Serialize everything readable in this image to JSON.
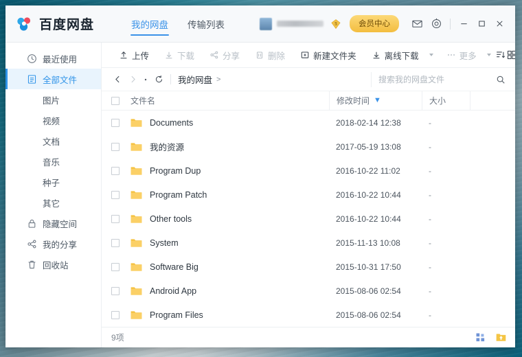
{
  "app": {
    "brand_name": "百度网盘",
    "logo_icon": "baidu-netdisk-logo"
  },
  "tabs": [
    {
      "label": "我的网盘",
      "active": true
    },
    {
      "label": "传输列表",
      "active": false
    }
  ],
  "account": {
    "username_masked": "",
    "diamond_icon": "diamond-badge-icon",
    "vip_label": "会员中心"
  },
  "titlebar_icons": [
    {
      "name": "mail-icon",
      "glyph": "mail"
    },
    {
      "name": "settings-icon",
      "glyph": "gear"
    }
  ],
  "window_controls": [
    {
      "name": "minimize-button",
      "glyph": "minimize"
    },
    {
      "name": "maximize-button",
      "glyph": "maximize"
    },
    {
      "name": "close-button",
      "glyph": "close"
    }
  ],
  "sidebar": {
    "items": [
      {
        "label": "最近使用",
        "icon": "clock-icon",
        "active": false
      },
      {
        "label": "全部文件",
        "icon": "file-list-icon",
        "active": true
      },
      {
        "label": "图片",
        "icon": "",
        "active": false
      },
      {
        "label": "视频",
        "icon": "",
        "active": false
      },
      {
        "label": "文档",
        "icon": "",
        "active": false
      },
      {
        "label": "音乐",
        "icon": "",
        "active": false
      },
      {
        "label": "种子",
        "icon": "",
        "active": false
      },
      {
        "label": "其它",
        "icon": "",
        "active": false
      },
      {
        "label": "隐藏空间",
        "icon": "lock-icon",
        "active": false
      },
      {
        "label": "我的分享",
        "icon": "share-icon",
        "active": false
      },
      {
        "label": "回收站",
        "icon": "trash-icon",
        "active": false
      }
    ]
  },
  "toolbar": {
    "buttons": [
      {
        "label": "上传",
        "icon": "upload-icon",
        "disabled": false,
        "caret": false
      },
      {
        "label": "下载",
        "icon": "download-icon",
        "disabled": true,
        "caret": false
      },
      {
        "label": "分享",
        "icon": "share-icon",
        "disabled": true,
        "caret": false
      },
      {
        "label": "删除",
        "icon": "trash-icon",
        "disabled": true,
        "caret": false
      },
      {
        "label": "新建文件夹",
        "icon": "new-folder-icon",
        "disabled": false,
        "caret": false
      },
      {
        "label": "离线下载",
        "icon": "offline-download-icon",
        "disabled": false,
        "caret": true
      },
      {
        "label": "更多",
        "icon": "ellipsis-icon",
        "disabled": true,
        "caret": true
      }
    ],
    "sort_icon": "sort-descending-icon",
    "grid_icon": "grid-view-icon"
  },
  "breadcrumb": {
    "back_icon": "chevron-left-icon",
    "forward_icon": "chevron-right-icon",
    "dot_icon": "dot-icon",
    "refresh_icon": "refresh-icon",
    "path": "我的网盘",
    "path_chevron": ">"
  },
  "search": {
    "placeholder": "搜索我的网盘文件",
    "value": "",
    "icon": "search-icon"
  },
  "table": {
    "headers": {
      "name": "文件名",
      "time": "修改时间",
      "size": "大小",
      "sort_arrow": "▼"
    },
    "rows": [
      {
        "name": "Documents",
        "time": "2018-02-14 12:38",
        "size": "-",
        "icon": "folder-icon"
      },
      {
        "name": "我的资源",
        "time": "2017-05-19 13:08",
        "size": "-",
        "icon": "folder-icon"
      },
      {
        "name": "Program Dup",
        "time": "2016-10-22 11:02",
        "size": "-",
        "icon": "folder-icon"
      },
      {
        "name": "Program Patch",
        "time": "2016-10-22 10:44",
        "size": "-",
        "icon": "folder-icon"
      },
      {
        "name": "Other tools",
        "time": "2016-10-22 10:44",
        "size": "-",
        "icon": "folder-icon"
      },
      {
        "name": "System",
        "time": "2015-11-13 10:08",
        "size": "-",
        "icon": "folder-icon"
      },
      {
        "name": "Software Big",
        "time": "2015-10-31 17:50",
        "size": "-",
        "icon": "folder-icon"
      },
      {
        "name": "Android App",
        "time": "2015-08-06 02:54",
        "size": "-",
        "icon": "folder-icon"
      },
      {
        "name": "Program Files",
        "time": "2015-08-06 02:54",
        "size": "-",
        "icon": "folder-icon"
      }
    ]
  },
  "statusbar": {
    "count_text": "9项",
    "icons": [
      {
        "name": "grid-squares-icon"
      },
      {
        "name": "folder-upload-icon"
      }
    ]
  },
  "colors": {
    "accent_blue": "#3a92e8",
    "vip_gold": "#f3bd3f",
    "folder_yellow": "#f5c344",
    "sidebar_active_bg": "#e9f4fd",
    "titlebar_bg": "#f7f9fb"
  }
}
